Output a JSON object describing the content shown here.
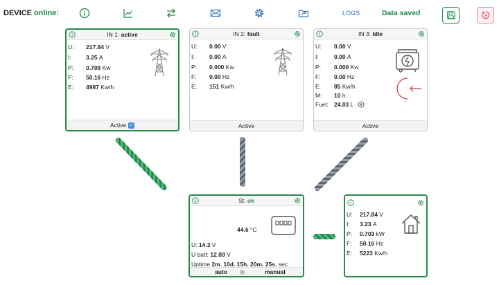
{
  "header": {
    "device_label": "DEVICE",
    "device_status": "online:",
    "logs_label": "LOGS",
    "saved_text": "Data saved"
  },
  "colors": {
    "green": "#1f8a48",
    "blue": "#2f77b8",
    "red": "#d9333f",
    "gray": "#888888"
  },
  "toolbar_icons": [
    "info-icon",
    "chart-icon",
    "swap-icon",
    "mail-icon",
    "gear-icon",
    "folder-share-icon",
    "save-icon",
    "reset-icon"
  ],
  "in1": {
    "title_prefix": "IN 1:",
    "title_state": "active",
    "rows": [
      {
        "k": "U:",
        "v": "217.84",
        "u": "V"
      },
      {
        "k": "I:",
        "v": "3.25",
        "u": "A"
      },
      {
        "k": "P:",
        "v": "0.709",
        "u": "Kw"
      },
      {
        "k": "F:",
        "v": "50.16",
        "u": "Hz"
      },
      {
        "k": "E:",
        "v": "4987",
        "u": "Kw/h"
      }
    ],
    "footer": "Active",
    "checked": true
  },
  "in2": {
    "title_prefix": "IN 2:",
    "title_state": "fault",
    "rows": [
      {
        "k": "U:",
        "v": "0.00",
        "u": "V"
      },
      {
        "k": "I:",
        "v": "0.00",
        "u": "A"
      },
      {
        "k": "P:",
        "v": "0.000",
        "u": "Kw"
      },
      {
        "k": "F:",
        "v": "0.00",
        "u": "Hz"
      },
      {
        "k": "E:",
        "v": "151",
        "u": "Kw/h"
      }
    ],
    "footer": "Active"
  },
  "in3": {
    "title_prefix": "IN 3:",
    "title_state": "Idle",
    "rows": [
      {
        "k": "U:",
        "v": "0.00",
        "u": "V"
      },
      {
        "k": "I:",
        "v": "0.00",
        "u": "A"
      },
      {
        "k": "P:",
        "v": "0.000",
        "u": "Kw"
      },
      {
        "k": "F:",
        "v": "0.00",
        "u": "Hz"
      },
      {
        "k": "E:",
        "v": "85",
        "u": "Kw/h"
      },
      {
        "k": "M:",
        "v": "10",
        "u": "h."
      },
      {
        "k": "Fuel:",
        "v": "24.03",
        "u": "L"
      }
    ],
    "footer": "Active"
  },
  "station": {
    "title_prefix": "St:",
    "title_state": "ok",
    "temp": "44.6",
    "temp_unit": "°C",
    "u_label": "U:",
    "u_value": "14.3",
    "u_unit": "V",
    "ubatt_label": "U batt:",
    "ubatt_value": "12.89",
    "ubatt_unit": "V",
    "uptime_label": "Uptime",
    "uptime_value": "2m. 10d. 15h. 20m. 25s.",
    "uptime_unit": "sec",
    "mode_auto": "auto",
    "mode_manual": "manual"
  },
  "output": {
    "rows": [
      {
        "k": "U:",
        "v": "217.84",
        "u": "V"
      },
      {
        "k": "I:",
        "v": "3.23",
        "u": "A"
      },
      {
        "k": "P:",
        "v": "0.703",
        "u": "kW"
      },
      {
        "k": "F:",
        "v": "50.16",
        "u": "Hz"
      },
      {
        "k": "E:",
        "v": "5223",
        "u": "Kw/h"
      }
    ]
  }
}
